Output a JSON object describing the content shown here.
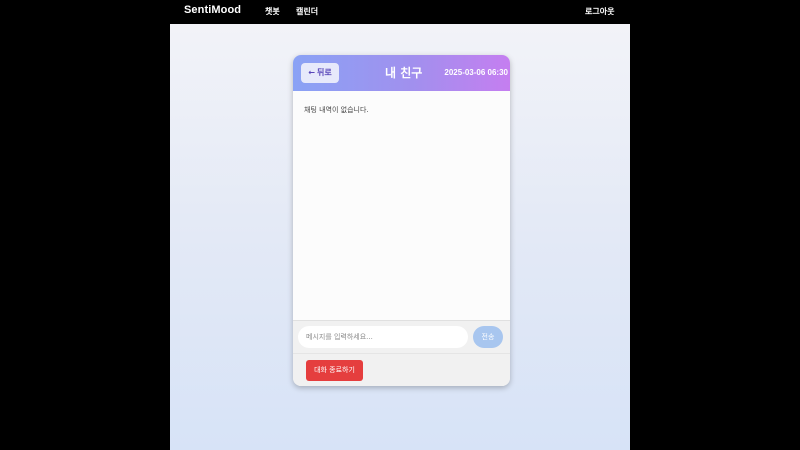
{
  "nav": {
    "brand": "SentiMood",
    "chatbot": "챗봇",
    "calendar": "캘린더",
    "logout": "로그아웃"
  },
  "chat": {
    "back_arrow": "←",
    "back_label": "뒤로",
    "title": "내 친구",
    "date": "2025-03-06 06:30",
    "empty_message": "채팅 내역이 없습니다.",
    "input_placeholder": "메시지를 입력하세요...",
    "input_value": "",
    "send_label": "전송",
    "end_label": "대화 종료하기"
  },
  "colors": {
    "header_gradient_start": "#8aa2f5",
    "header_gradient_end": "#c57ef0",
    "send_button": "#a8c6ef",
    "end_button": "#e53e3e"
  }
}
